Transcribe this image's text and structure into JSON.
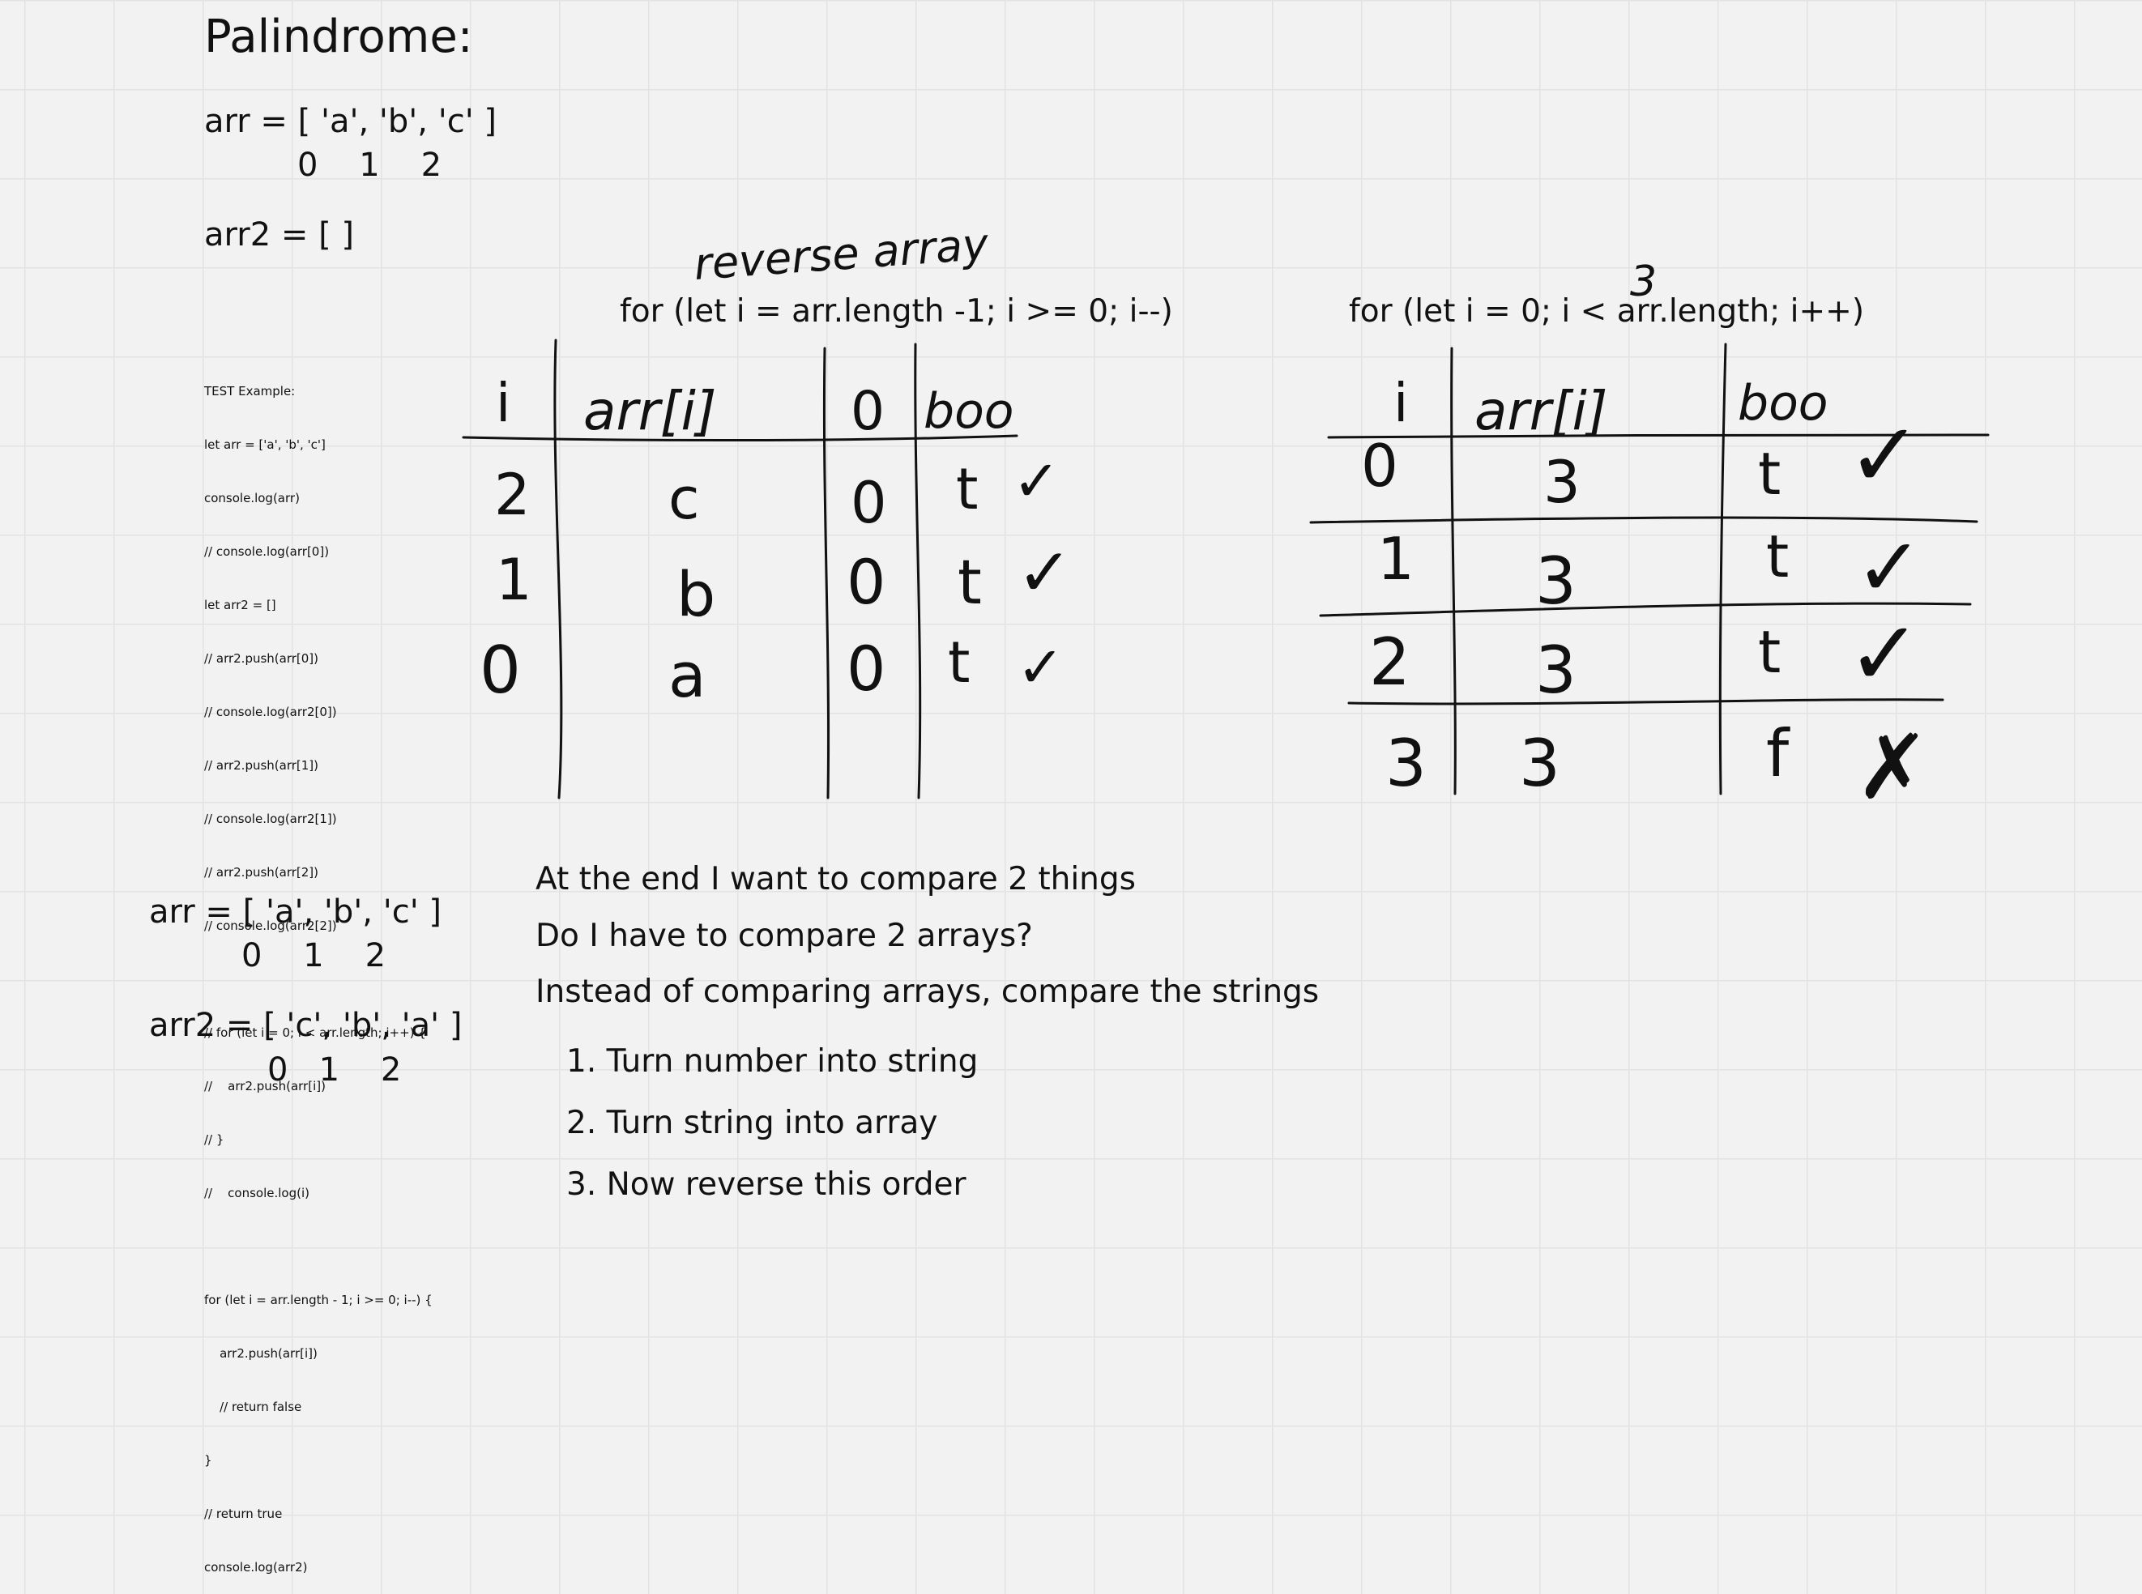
{
  "title": "Palindrome:",
  "example_top": {
    "arr": "arr = [ 'a', 'b', 'c' ]",
    "indices": "0    1    2",
    "arr2": "arr2 = [ ]"
  },
  "code_lines": [
    "TEST Example:",
    "let arr = ['a', 'b', 'c']",
    "console.log(arr)",
    "// console.log(arr[0])",
    "let arr2 = []",
    "// arr2.push(arr[0])",
    "// console.log(arr2[0])",
    "// arr2.push(arr[1])",
    "// console.log(arr2[1])",
    "// arr2.push(arr[2])",
    "// console.log(arr2[2])",
    "",
    "// for (let i = 0; i < arr.length; i++) {",
    "//    arr2.push(arr[i])",
    "// }",
    "//    console.log(i)",
    "",
    "for (let i = arr.length - 1; i >= 0; i--) {",
    "    arr2.push(arr[i])",
    "    // return false",
    "}",
    "// return true",
    "console.log(arr2)"
  ],
  "left_table": {
    "annotation": "reverse array",
    "loop": "for (let i = arr.length -1; i >= 0; i--)",
    "headers": [
      "i",
      "arr[i]",
      "0",
      "boo"
    ],
    "rows": [
      {
        "i": "2",
        "val": "c",
        "zero": "0",
        "boo": "t",
        "mark": "✓"
      },
      {
        "i": "1",
        "val": "b",
        "zero": "0",
        "boo": "t",
        "mark": "✓"
      },
      {
        "i": "0",
        "val": "a",
        "zero": "0",
        "boo": "t",
        "mark": "✓"
      }
    ]
  },
  "right_table": {
    "annotation": "3",
    "loop": "for (let i = 0; i < arr.length; i++)",
    "headers": [
      "i",
      "arr[i]",
      "boo"
    ],
    "rows": [
      {
        "i": "0",
        "val": "3",
        "boo": "t",
        "mark": "✓"
      },
      {
        "i": "1",
        "val": "3",
        "boo": "t",
        "mark": "✓"
      },
      {
        "i": "2",
        "val": "3",
        "boo": "t",
        "mark": "✓"
      },
      {
        "i": "3",
        "val": "3",
        "boo": "f",
        "mark": "✗"
      }
    ]
  },
  "example_bottom": {
    "arr": "arr = [ 'a', 'b', 'c' ]",
    "arr_indices": "0    1    2",
    "arr2": "arr2 = [ 'c', 'b', 'a' ]",
    "arr2_indices": "0   1    2"
  },
  "notes": [
    "At the end I want to compare 2 things",
    "Do I have to compare 2 arrays?",
    "Instead of comparing arrays, compare the strings"
  ],
  "steps": [
    "1. Turn number into string",
    "2. Turn string into array",
    "3. Now reverse this order"
  ]
}
